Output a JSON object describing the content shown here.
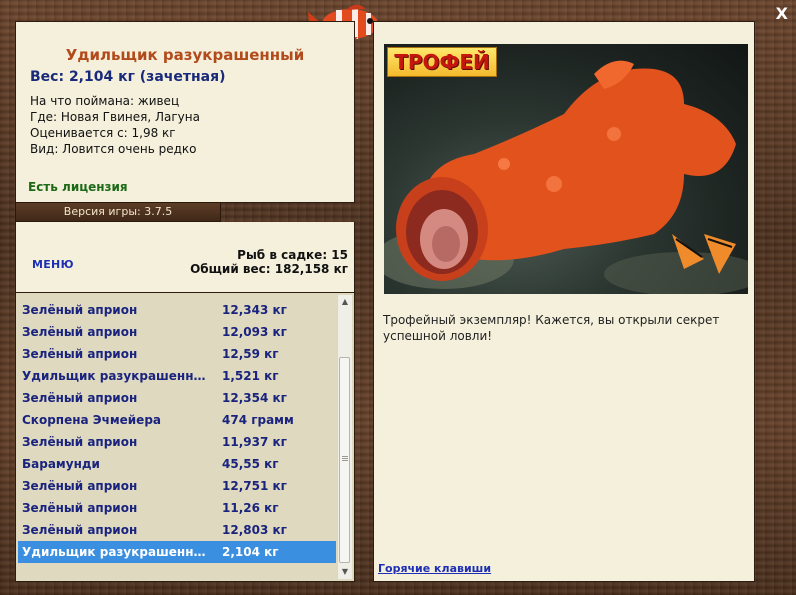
{
  "window": {
    "close_label": "X"
  },
  "info": {
    "fish_name": "Удильщик разукрашенный",
    "weight_line": "Вес: 2,104 кг (зачетная)",
    "bait": "На что поймана: живец",
    "location": "Где: Новая Гвинея, Лагуна",
    "valued_from": "Оценивается с: 1,98 кг",
    "rarity": "Вид: Ловится очень редко",
    "license": "Есть лицензия"
  },
  "version_label": "Версия игры: 3.7.5",
  "menu": {
    "menu_label": "МЕНЮ",
    "fish_count": "Рыб в садке: 15",
    "total_weight": "Общий вес: 182,158 кг"
  },
  "catch_list": [
    {
      "name": "Зелёный априон",
      "weight": "12,343 кг"
    },
    {
      "name": "Зелёный априон",
      "weight": "12,093 кг"
    },
    {
      "name": "Зелёный априон",
      "weight": "12,59 кг"
    },
    {
      "name": "Удильщик разукрашенный",
      "weight": "1,521 кг"
    },
    {
      "name": "Зелёный априон",
      "weight": "12,354 кг"
    },
    {
      "name": "Скорпена Эчмейера",
      "weight": "474 грамм"
    },
    {
      "name": "Зелёный априон",
      "weight": "11,937 кг"
    },
    {
      "name": "Барамунди",
      "weight": "45,55 кг"
    },
    {
      "name": "Зелёный априон",
      "weight": "12,751 кг"
    },
    {
      "name": "Зелёный априон",
      "weight": "11,26 кг"
    },
    {
      "name": "Зелёный априон",
      "weight": "12,803 кг"
    },
    {
      "name": "Удильщик разукрашенный",
      "weight": "2,104 кг",
      "selected": true
    }
  ],
  "trophy": {
    "badge": "ТРОФЕЙ",
    "description": "Трофейный экземпляр! Кажется, вы открыли секрет успешной ловли!",
    "hotkeys_label": "Горячие клавиши"
  },
  "colors": {
    "panel_bg": "#f4f0dc",
    "fish_name": "#b24a1b",
    "list_text": "#1a237e",
    "selection": "#3b8fe0",
    "license": "#1c6a16"
  }
}
